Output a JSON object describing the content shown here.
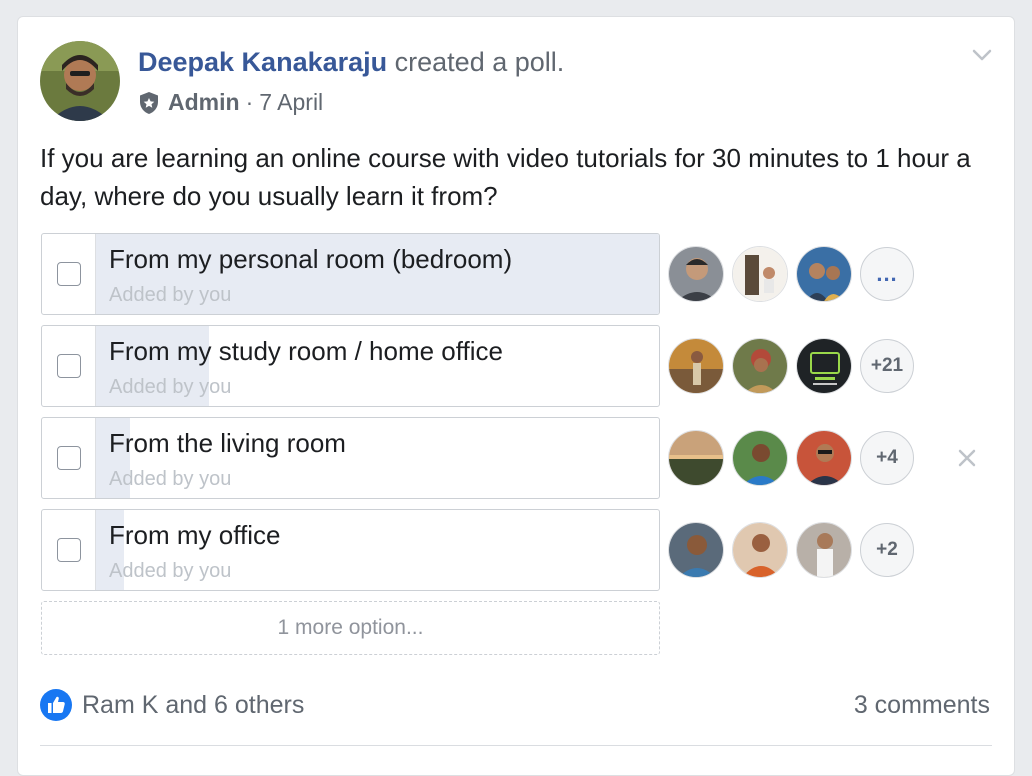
{
  "post": {
    "author": "Deepak Kanakaraju",
    "action": "created a poll.",
    "role": "Admin",
    "separator": "·",
    "date": "7 April",
    "question": "If you are learning an online course with video tutorials for 30 minutes to 1 hour a day, where do you usually learn it from?"
  },
  "poll": {
    "options": [
      {
        "label": "From my personal room (bedroom)",
        "added_by": "Added by you",
        "vote_share": 1.0,
        "more": "..."
      },
      {
        "label": "From my study room / home office",
        "added_by": "Added by you",
        "vote_share": 0.2,
        "more": "+21"
      },
      {
        "label": "From the living room",
        "added_by": "Added by you",
        "vote_share": 0.06,
        "more": "+4"
      },
      {
        "label": "From my office",
        "added_by": "Added by you",
        "vote_share": 0.05,
        "more": "+2"
      }
    ],
    "more_options": "1 more option..."
  },
  "footer": {
    "likes": "Ram K and 6 others",
    "comments": "3 comments"
  },
  "colors": {
    "author_blue": "#385898",
    "like_blue": "#1877f2",
    "vote_fill": "#e7ebf3"
  }
}
